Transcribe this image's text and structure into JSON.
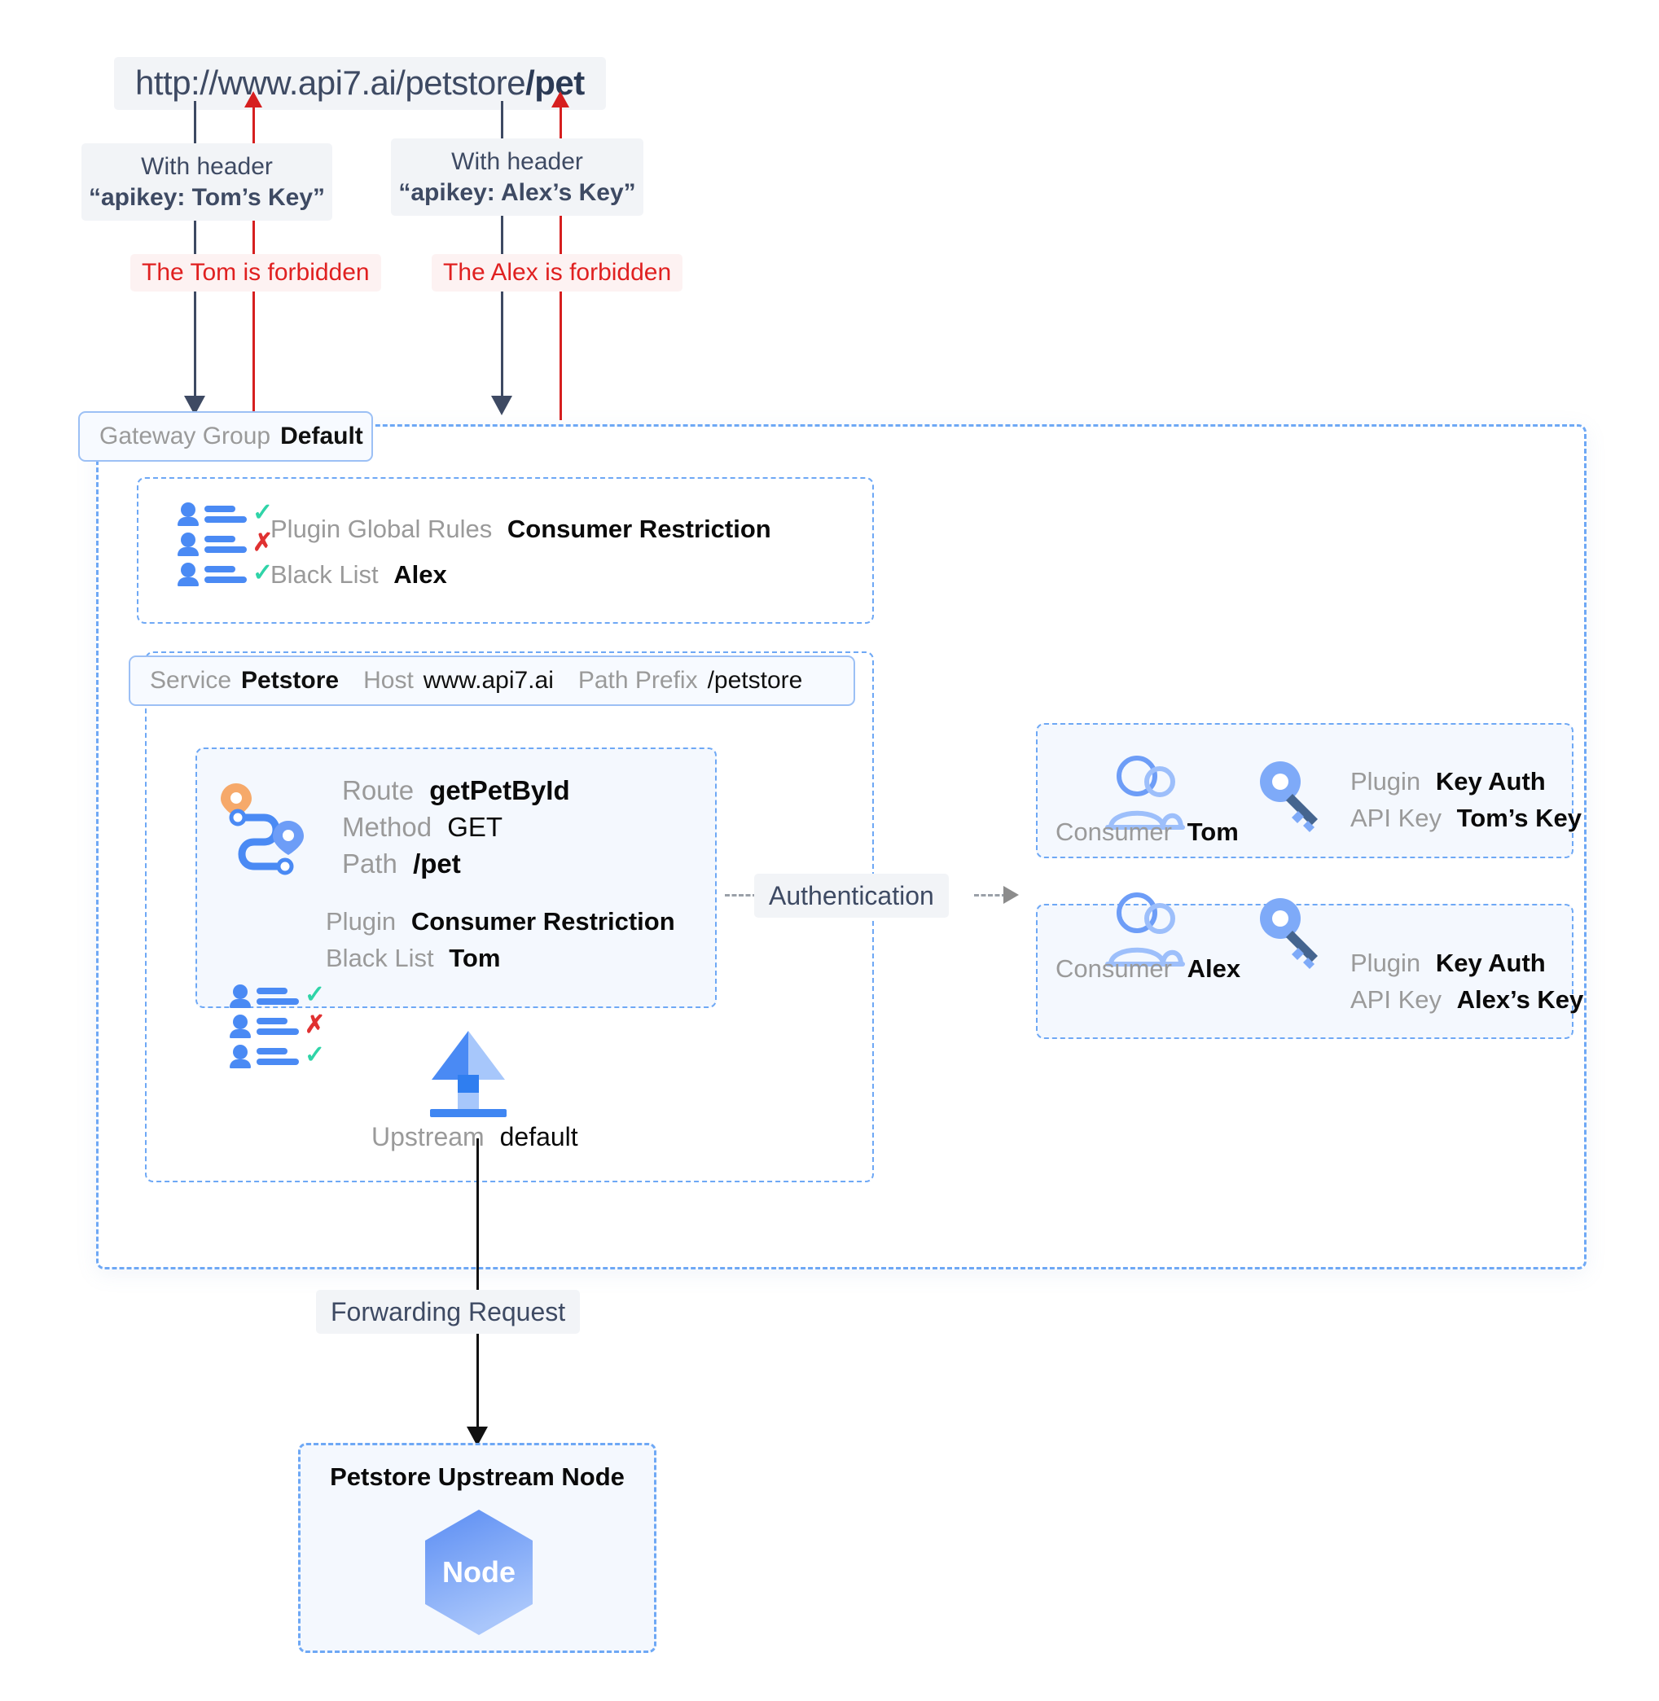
{
  "request": {
    "url_prefix": "http://www.api7.ai/petstore",
    "url_suffix": "/pet",
    "flows": [
      {
        "header_line1": "With header",
        "header_line2": "“apikey: Tom’s Key”",
        "forbidden": "The Tom is forbidden"
      },
      {
        "header_line1": "With header",
        "header_line2": "“apikey: Alex’s Key”",
        "forbidden": "The Alex is forbidden"
      }
    ]
  },
  "gateway_group": {
    "label": "Gateway Group",
    "value": "Default"
  },
  "global_rules": {
    "plugin_label": "Plugin Global Rules",
    "plugin_value": "Consumer Restriction",
    "list_label": "Black List",
    "list_value": "Alex",
    "icon": "consumer-restriction-icon",
    "marks": [
      "check",
      "cross",
      "check"
    ]
  },
  "service": {
    "label": "Service",
    "value": "Petstore",
    "host_label": "Host",
    "host_value": "www.api7.ai",
    "path_prefix_label": "Path Prefix",
    "path_prefix_value": "/petstore"
  },
  "route": {
    "icon": "route-path-icon",
    "route_label": "Route",
    "route_value": "getPetById",
    "method_label": "Method",
    "method_value": "GET",
    "path_label": "Path",
    "path_value": "/pet",
    "plugin_label": "Plugin",
    "plugin_value": "Consumer Restriction",
    "list_label": "Black List",
    "list_value": "Tom",
    "plugin_icon": "consumer-restriction-icon",
    "marks": [
      "check",
      "cross",
      "check"
    ]
  },
  "authentication": {
    "label": "Authentication"
  },
  "consumers": [
    {
      "icon": "people-icon",
      "consumer_label": "Consumer",
      "consumer_value": "Tom",
      "key_icon": "key-icon",
      "plugin_label": "Plugin",
      "plugin_value": "Key Auth",
      "api_key_label": "API Key",
      "api_key_value": "Tom’s Key"
    },
    {
      "icon": "people-icon",
      "consumer_label": "Consumer",
      "consumer_value": "Alex",
      "key_icon": "key-icon",
      "plugin_label": "Plugin",
      "plugin_value": "Key Auth",
      "api_key_label": "API Key",
      "api_key_value": "Alex’s Key"
    }
  ],
  "upstream": {
    "icon": "upstream-upload-icon",
    "label": "Upstream",
    "value": "default"
  },
  "forwarding": {
    "label": "Forwarding Request"
  },
  "upstream_node": {
    "title": "Petstore Upstream Node",
    "node_label": "Node"
  },
  "colors": {
    "dashed_blue": "#6ea8f5",
    "solid_blue": "#9cc0f5",
    "panel_fill": "#f4f8fe",
    "chip_bg": "#f2f4f7",
    "chip_text": "#3e4a63",
    "forbidden_text": "#e02020",
    "forbidden_bg": "#fdf2f2",
    "icon_blue": "#4a8af4",
    "icon_light_blue": "#a7c7fb",
    "icon_orange": "#f6a96a",
    "check_green": "#2fd4a8",
    "cross_red": "#e03131",
    "arrow_dark": "#3e4a63",
    "arrow_red": "#d61f1f",
    "label_gray": "#9a9a9a"
  }
}
